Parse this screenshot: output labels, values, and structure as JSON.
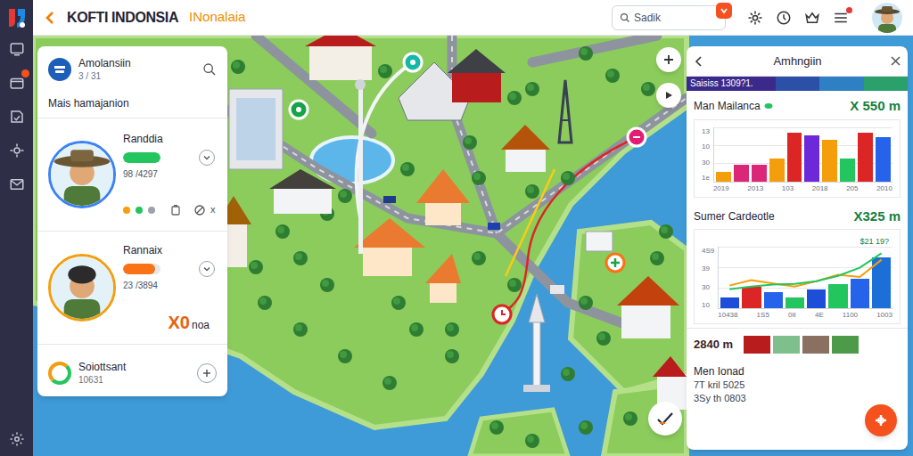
{
  "sidebar": {
    "items": [
      {
        "badge": false
      },
      {
        "badge": true
      },
      {
        "badge": false
      },
      {
        "badge": false
      },
      {
        "badge": false
      }
    ]
  },
  "header": {
    "title": "KOFTI INDONSIA",
    "subtitle": "INonalaia",
    "search": {
      "placeholder": "Sadik"
    },
    "menu_dot": true
  },
  "left_panel": {
    "title": "Amolansiin",
    "subtitle": "3 / 31",
    "section": "Mais hamajanion",
    "people": [
      {
        "kind": "dots",
        "name": "Randdia",
        "level": 1,
        "color": "#22c55e",
        "avatar_ring": "#3b82f6",
        "reading": "98 /4297",
        "dots": [
          "#f59e0b",
          "#22c55e",
          "#9ca3af"
        ],
        "tag": "x"
      },
      {
        "kind": "amount",
        "name": "Rannaix",
        "level": 0.85,
        "color": "#f97316",
        "avatar_ring": "#f59e0b",
        "reading": "23 /3894",
        "amount": "X0",
        "unit": "noa"
      }
    ],
    "footer": {
      "name": "Soiottsant",
      "value": "10631"
    }
  },
  "right_panel": {
    "title": "Amhngiin",
    "strip": {
      "label": "Saisiss 1309?1.",
      "segments": [
        {
          "color": "#3b2a8c"
        },
        {
          "color": "#2c4fa8"
        },
        {
          "color": "#2f7fc4"
        },
        {
          "color": "#2aa06a"
        }
      ]
    },
    "charts": [
      {
        "label": "Man Mailanca",
        "value": "X 550 m",
        "ticks": [
          "13",
          "10",
          "30",
          "1e"
        ],
        "x_labels": [
          "2019",
          "2013",
          "103",
          "2018",
          "205",
          "2010"
        ],
        "bars": {
          "values": [
            2,
            3.5,
            3.5,
            5,
            10.5,
            10,
            9,
            5,
            10.5,
            9.5
          ],
          "colors": [
            "#f59e0b",
            "#db2777",
            "#db2777",
            "#f59e0b",
            "#dc2626",
            "#6d28d9",
            "#f59e0b",
            "#22c55e",
            "#dc2626",
            "#2563eb"
          ]
        }
      },
      {
        "label": "Sumer Cardeotle",
        "value": "X325 m",
        "note": "$21 19?",
        "ticks": [
          "4S9",
          "39",
          "30",
          "10"
        ],
        "x_labels": [
          "10438",
          "1S5",
          "0II",
          "4E",
          "1100",
          "1003"
        ],
        "bars": {
          "values": [
            2,
            4,
            3,
            2,
            3.5,
            4.5,
            5.5,
            9.5
          ],
          "colors": [
            "#1d4ed8",
            "#dc2626",
            "#2563eb",
            "#22c55e",
            "#1d4ed8",
            "#22c55e",
            "#2563eb",
            "#1d6fd8"
          ]
        },
        "lines": [
          {
            "color": "#f59e0b",
            "values": [
              4.2,
              5.2,
              4.6,
              4.0,
              5.0,
              6.2,
              5.8,
              9.0
            ]
          },
          {
            "color": "#22c55e",
            "values": [
              3.5,
              4.0,
              4.4,
              4.5,
              5.0,
              6.0,
              7.5,
              10.2
            ]
          }
        ]
      }
    ],
    "gallery": {
      "value": "2840 m"
    },
    "footer": {
      "label": "Men Ionad",
      "lines": [
        "7T kril 5025",
        "3Sy th 0803"
      ]
    }
  }
}
